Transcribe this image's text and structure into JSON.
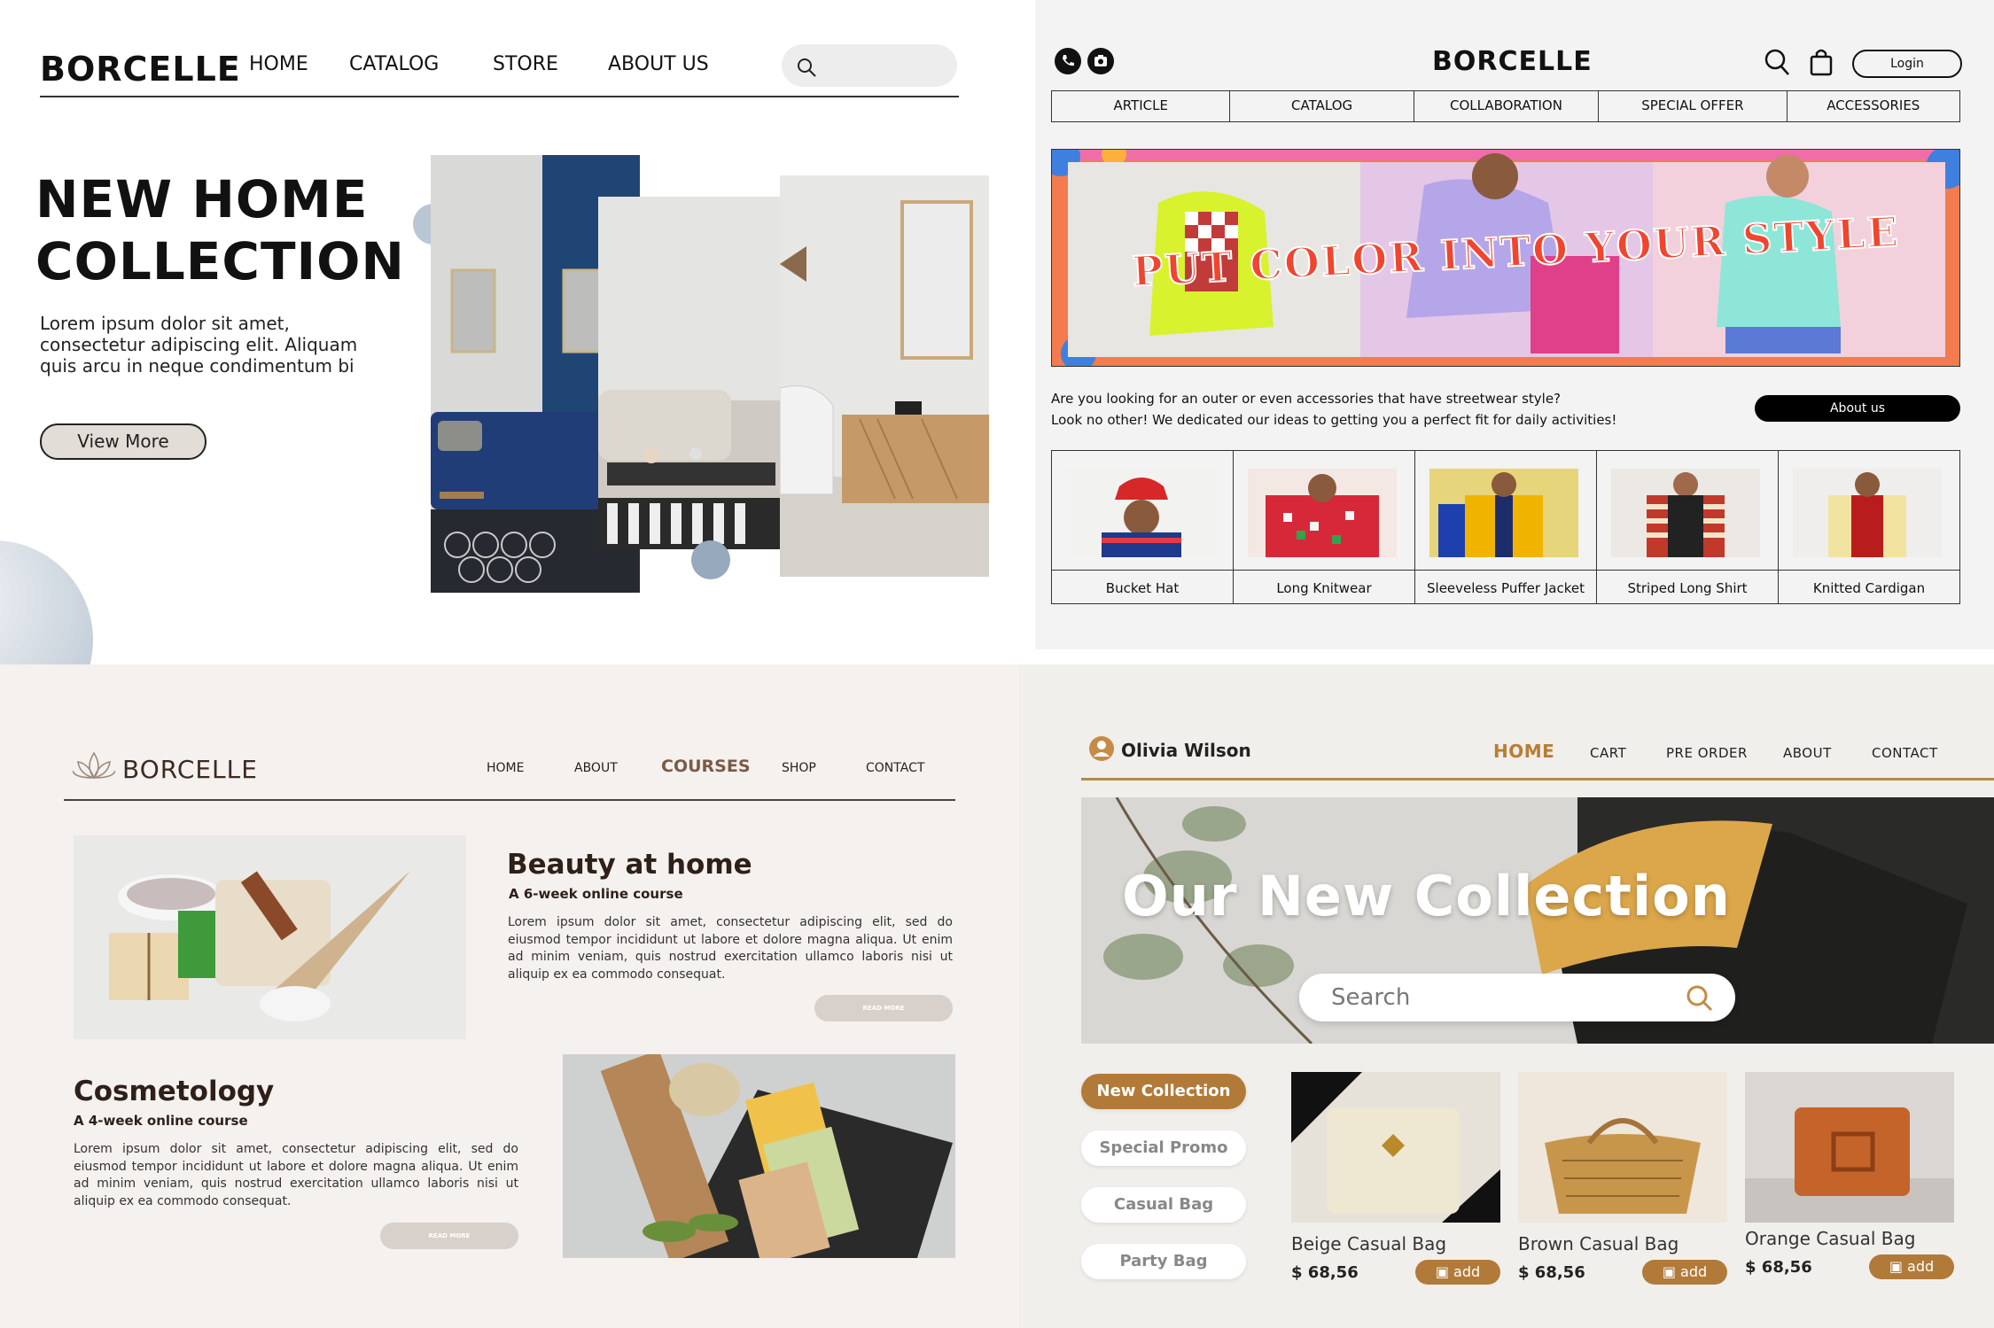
{
  "q1": {
    "logo": "BORCELLE",
    "nav": [
      "HOME",
      "CATALOG",
      "STORE",
      "ABOUT US"
    ],
    "hero_title_line1": "NEW HOME",
    "hero_title_line2": "COLLECTION",
    "hero_body": "Lorem ipsum dolor sit amet, consectetur adipiscing elit. Aliquam quis arcu in neque condimentum bi",
    "view_more": "View More"
  },
  "q2": {
    "logo": "BORCELLE",
    "login": "Login",
    "menu": [
      "ARTICLE",
      "CATALOG",
      "COLLABORATION",
      "SPECIAL OFFER",
      "ACCESSORIES"
    ],
    "banner_text": "PUT COLOR INTO YOUR STYLE",
    "intro_line1": "Are you looking for an outer or even accessories that have streetwear style?",
    "intro_line2": "Look no other! We dedicated our ideas to getting you a perfect fit for daily activities!",
    "about": "About us",
    "products": [
      "Bucket Hat",
      "Long Knitwear",
      "Sleeveless Puffer Jacket",
      "Striped Long Shirt",
      "Knitted Cardigan"
    ]
  },
  "q3": {
    "logo": "BORCELLE",
    "nav": [
      "HOME",
      "ABOUT",
      "COURSES",
      "SHOP",
      "CONTACT"
    ],
    "course1_title": "Beauty at home",
    "course1_sub": "A 6-week online course",
    "course1_body": "Lorem ipsum dolor sit amet, consectetur adipiscing elit, sed do eiusmod tempor incididunt ut labore et dolore magna aliqua. Ut enim ad minim veniam, quis nostrud exercitation ullamco laboris nisi ut aliquip ex ea commodo consequat.",
    "course2_title": "Cosmetology",
    "course2_sub": "A 4-week online course",
    "course2_body": "Lorem ipsum dolor sit amet, consectetur adipiscing elit, sed do eiusmod tempor incididunt ut labore et dolore magna aliqua. Ut enim ad minim veniam, quis nostrud exercitation ullamco laboris nisi ut aliquip ex ea commodo consequat.",
    "read_more": "READ MORE"
  },
  "q4": {
    "user": "Olivia Wilson",
    "nav": [
      "HOME",
      "CART",
      "PRE ORDER",
      "ABOUT",
      "CONTACT"
    ],
    "hero_title": "Our New Collection",
    "search_placeholder": "Search",
    "categories": [
      "New Collection",
      "Special Promo",
      "Casual Bag",
      "Party Bag"
    ],
    "products": [
      {
        "name": "Beige Casual Bag",
        "price": "$ 68,56",
        "add": "add"
      },
      {
        "name": "Brown Casual Bag",
        "price": "$ 68,56",
        "add": "add"
      },
      {
        "name": "Orange Casual Bag",
        "price": "$ 68,56",
        "add": "add"
      }
    ]
  },
  "colors": {
    "q4_accent": "#b27a38",
    "q3_heading": "#2e1f18",
    "q2_black": "#000000"
  },
  "icons": [
    "search-icon",
    "phone-icon",
    "camera-icon",
    "shopping-bag-icon",
    "lotus-icon",
    "user-icon",
    "bag-icon"
  ]
}
